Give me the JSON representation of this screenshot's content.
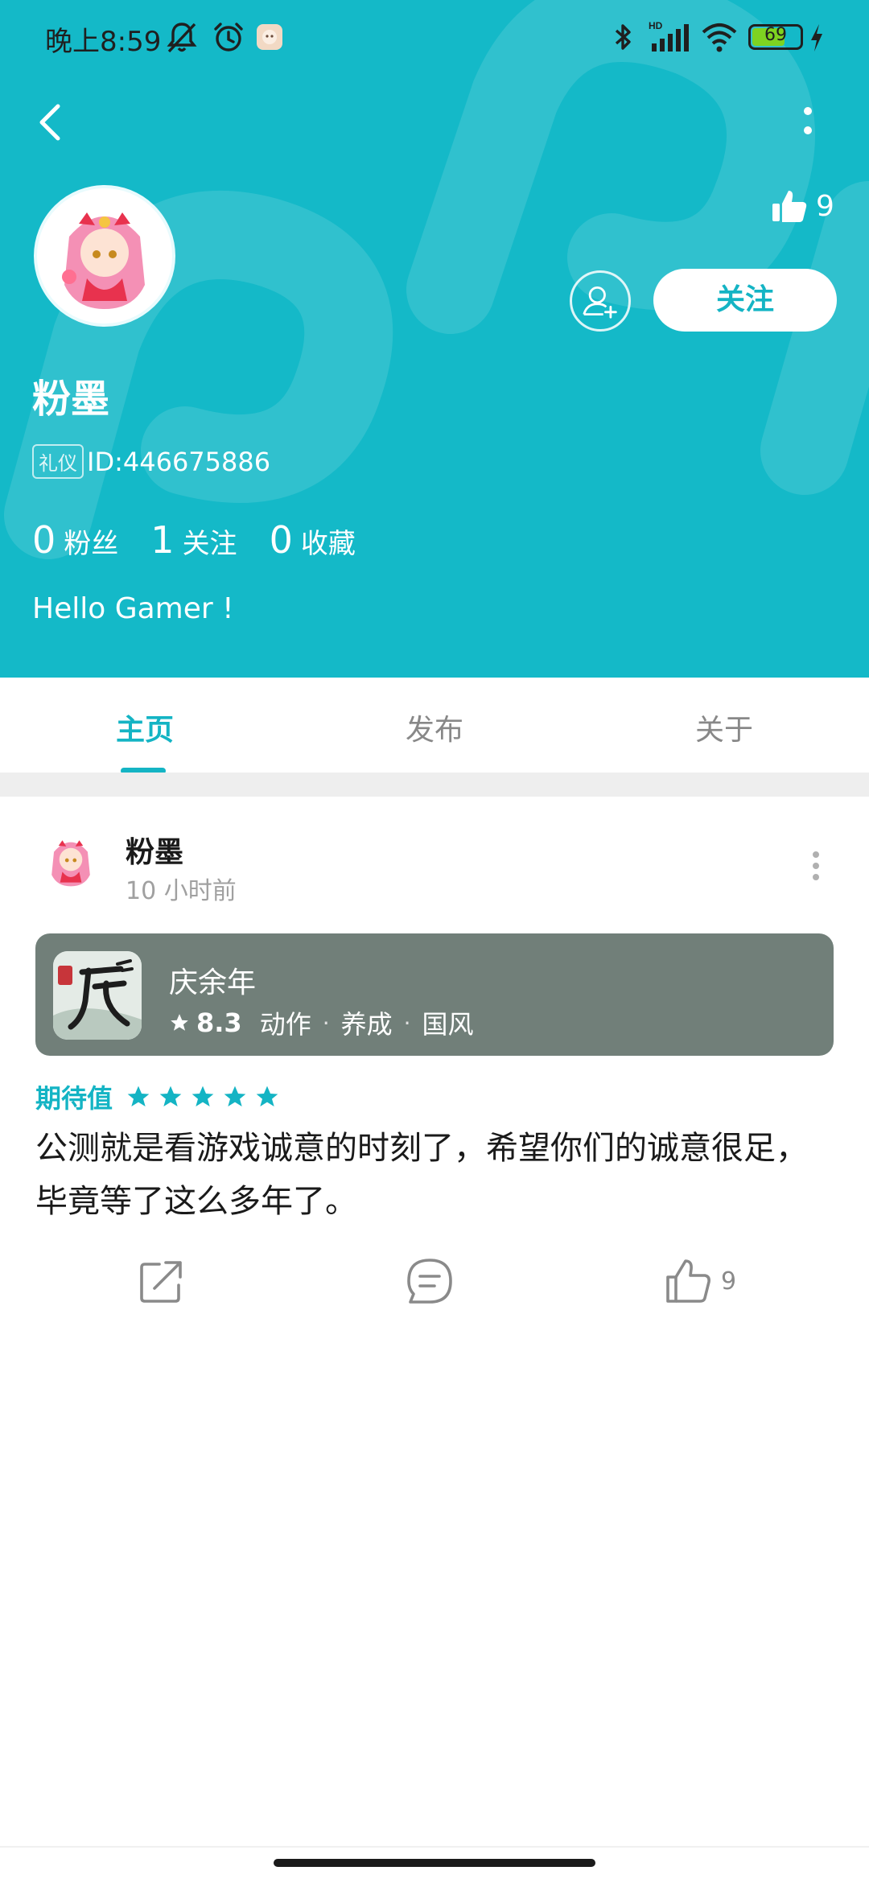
{
  "status_bar": {
    "time": "晚上8:59",
    "battery_level": "69",
    "battery_fraction": 0.69,
    "signal_label": "HD"
  },
  "header": {
    "likes_count": "9",
    "follow_label": "关注",
    "username": "粉墨",
    "tag": "礼仪",
    "user_id": "ID:446675886",
    "stats": [
      {
        "count": "0",
        "label": "粉丝"
      },
      {
        "count": "1",
        "label": "关注"
      },
      {
        "count": "0",
        "label": "收藏"
      }
    ],
    "bio": "Hello Gamer !"
  },
  "tabs": [
    {
      "label": "主页",
      "active": true
    },
    {
      "label": "发布",
      "active": false
    },
    {
      "label": "关于",
      "active": false
    }
  ],
  "post": {
    "author": "粉墨",
    "time": "10 小时前",
    "game": {
      "title": "庆余年",
      "score": "8.3",
      "tags": [
        "动作",
        "养成",
        "国风"
      ]
    },
    "expect_label": "期待值",
    "stars": 5,
    "body": "公测就是看游戏诚意的时刻了，希望你们的诚意很足，毕竟等了这么多年了。",
    "like_count": "9"
  },
  "colors": {
    "accent": "#14b9c8",
    "card": "#717f79"
  }
}
